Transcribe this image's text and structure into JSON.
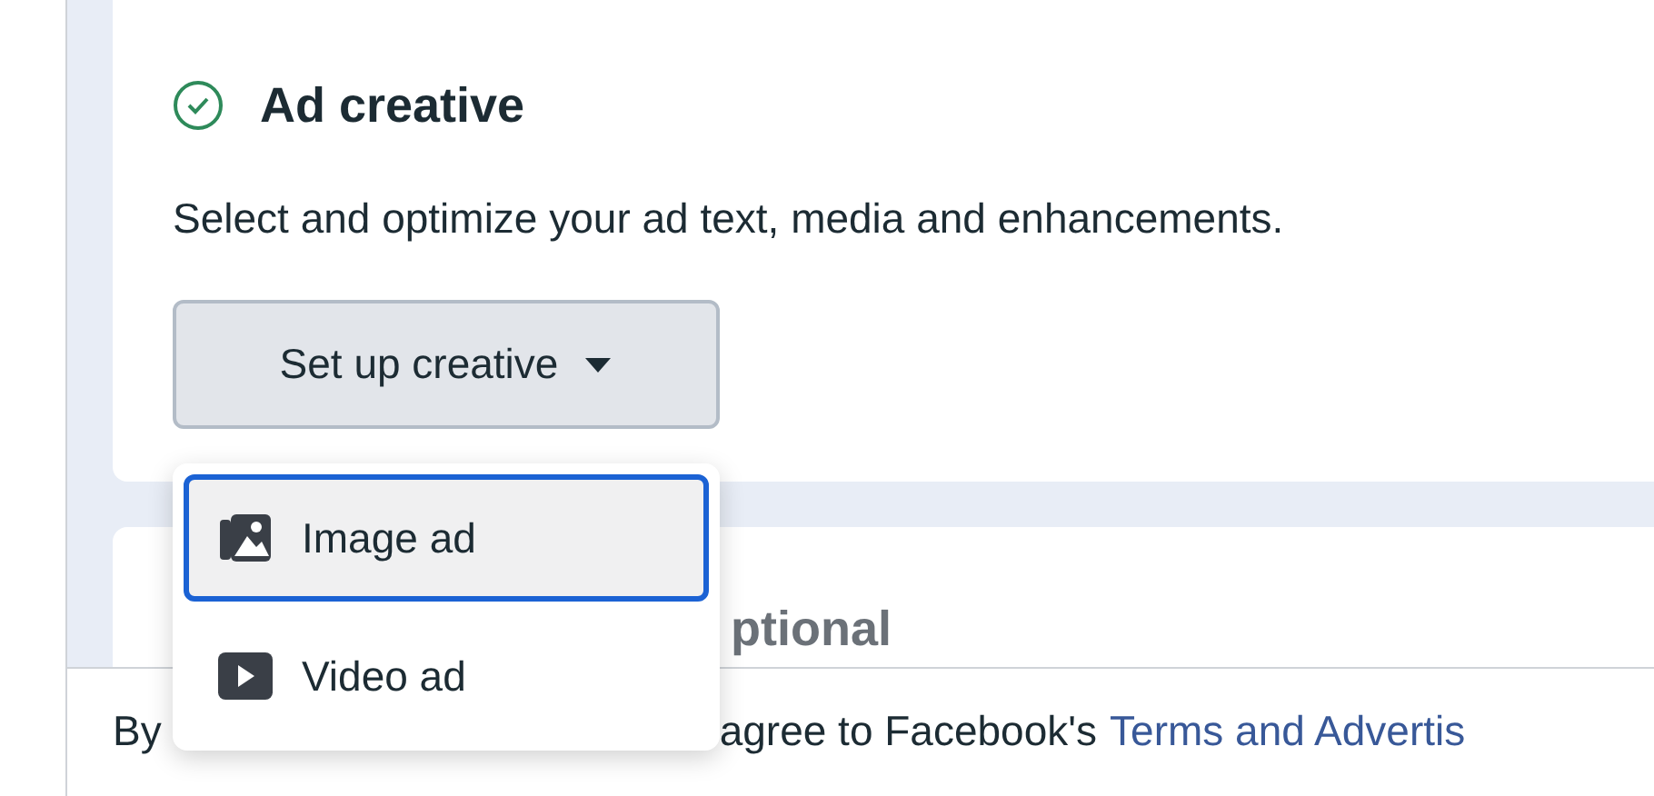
{
  "ad_creative": {
    "title": "Ad creative",
    "completed": true,
    "description": "Select and optimize your ad text, media and enhancements.",
    "button": {
      "label": "Set up creative",
      "expanded": true
    }
  },
  "menu": [
    {
      "kind": "image",
      "label": "Image ad",
      "selected": true
    },
    {
      "kind": "video",
      "label": "Video ad",
      "selected": false
    }
  ],
  "next_section": {
    "title": "ptional"
  },
  "footer": {
    "lead": "By",
    "text": "agree to Facebook's",
    "link": "Terms and Advertis"
  }
}
